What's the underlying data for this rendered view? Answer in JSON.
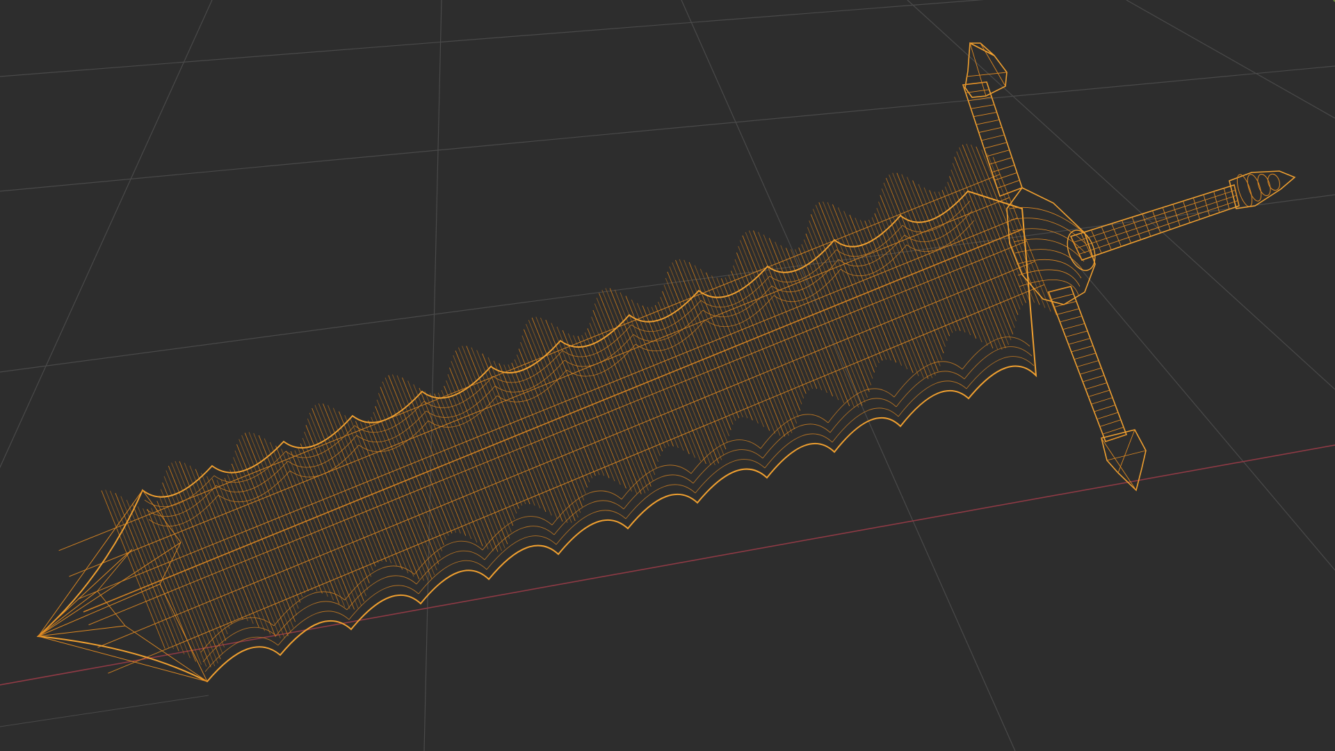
{
  "viewport": {
    "mode": "wireframe",
    "object": "sword-mesh",
    "selected": true
  },
  "colors": {
    "background": "#2d2d2d",
    "grid": "#4a4a4a",
    "x_axis": "#8f3a45",
    "y_axis": "#6a8a3a",
    "wire": "#e08a22",
    "wire_dense": "#c97a1a",
    "wire_edge": "#f0a030"
  },
  "icons": []
}
